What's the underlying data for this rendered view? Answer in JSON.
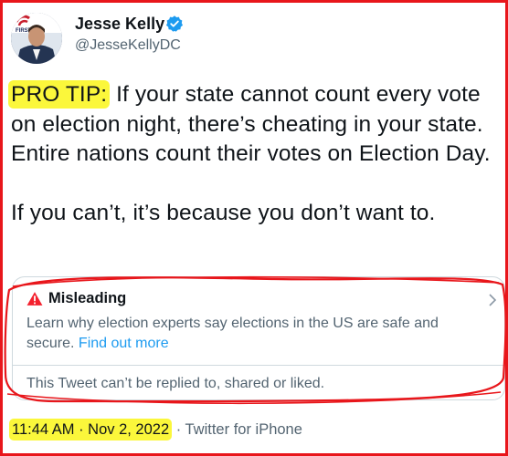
{
  "author": {
    "name": "Jesse Kelly",
    "handle": "@JesseKellyDC",
    "verified": true,
    "avatar_badge_text": "FIRST",
    "verified_icon": "verified-badge-icon"
  },
  "tweet": {
    "highlight_prefix": "PRO TIP:",
    "line1_rest": " If your state cannot count every vote on election night, there’s cheating in your state. Entire nations count their votes on Election Day.",
    "paragraph2": "If you can’t, it’s because you don’t want to."
  },
  "notice": {
    "icon": "warning-triangle-icon",
    "title": "Misleading",
    "body": "Learn why election experts say elections in the US are safe and secure.",
    "link": "Find out more",
    "footer": "This Tweet can’t be replied to, shared or liked."
  },
  "meta": {
    "timestamp": "11:44 AM · Nov 2, 2022",
    "separator": " · ",
    "source": "Twitter for iPhone"
  },
  "colors": {
    "highlight": "#fbf73b",
    "annotation_red": "#e8161b",
    "link": "#1d9bf0",
    "verified": "#1d9bf0",
    "warning": "#f4212e"
  }
}
